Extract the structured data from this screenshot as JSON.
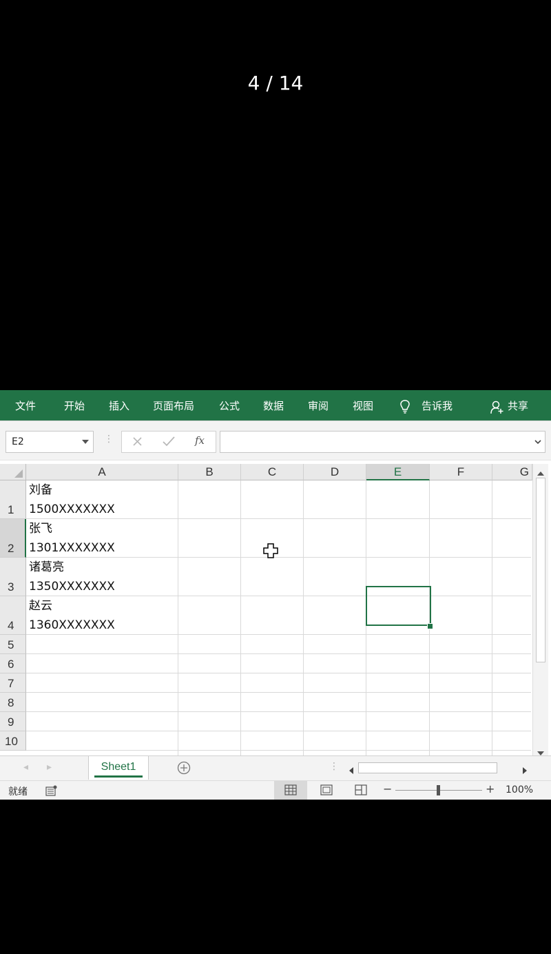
{
  "pager": {
    "text": "4 / 14"
  },
  "ribbon": {
    "tabs": [
      "文件",
      "开始",
      "插入",
      "页面布局",
      "公式",
      "数据",
      "审阅",
      "视图"
    ],
    "tell_me": "告诉我",
    "share": "共享"
  },
  "formula_bar": {
    "name_box": "E2",
    "fx_label": "fx",
    "value": ""
  },
  "columns": [
    "A",
    "B",
    "C",
    "D",
    "E",
    "F",
    "G"
  ],
  "rows": [
    "1",
    "2",
    "3",
    "4",
    "5",
    "6",
    "7",
    "8",
    "9",
    "10"
  ],
  "cells": [
    {
      "name": "刘备",
      "phone": "1500XXXXXXX"
    },
    {
      "name": "张飞",
      "phone": "1301XXXXXXX"
    },
    {
      "name": "诸葛亮",
      "phone": "1350XXXXXXX"
    },
    {
      "name": "赵云",
      "phone": "1360XXXXXXX"
    }
  ],
  "selected_cell": "E2",
  "sheet": {
    "active_tab": "Sheet1"
  },
  "status": {
    "ready": "就绪",
    "zoom": "100%"
  },
  "colors": {
    "brand": "#217346",
    "ribbon_text": "#ffffff",
    "grid_line": "#d9d9d9"
  },
  "icons": [
    "lightbulb-icon",
    "user-icon",
    "cancel-icon",
    "enter-icon",
    "fx-icon",
    "add-sheet-icon",
    "normal-view-icon",
    "page-layout-icon",
    "page-break-icon",
    "cursor-cross-icon"
  ]
}
